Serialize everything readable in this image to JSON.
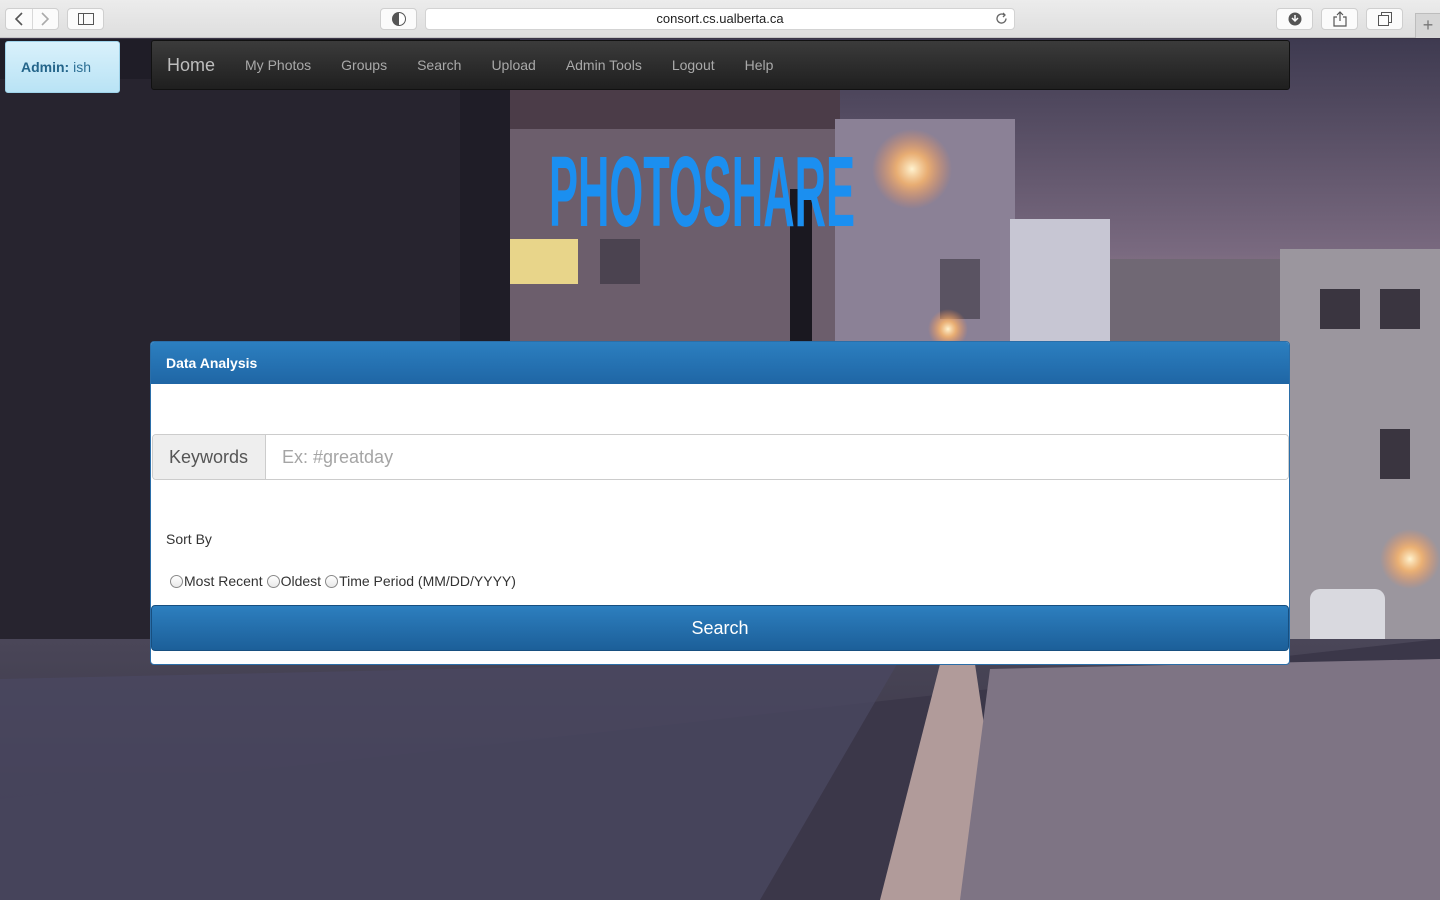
{
  "browser": {
    "url": "consort.cs.ualberta.ca",
    "icons": [
      "back-icon",
      "forward-icon",
      "sidebar-icon",
      "privacy-icon",
      "reload-icon",
      "download-icon",
      "share-icon",
      "tabs-icon",
      "new-tab-icon"
    ]
  },
  "admin_badge": {
    "label": "Admin:",
    "user": "ish"
  },
  "navbar": {
    "brand": "Home",
    "links": [
      "My Photos",
      "Groups",
      "Search",
      "Upload",
      "Admin Tools",
      "Logout",
      "Help"
    ]
  },
  "logo": {
    "text": "PHOTOSHARE",
    "color": "#1b8ff0"
  },
  "panel": {
    "title": "Data Analysis",
    "keywords_label": "Keywords",
    "keywords_placeholder": "Ex: #greatday",
    "keywords_value": "",
    "sort_label": "Sort By",
    "sort_options": [
      "Most Recent",
      "Oldest",
      "Time Period (MM/DD/YYYY)"
    ],
    "search_button": "Search"
  },
  "colors": {
    "panel_heading": "#2373b4",
    "badge_bg": "#c9eaf8"
  }
}
